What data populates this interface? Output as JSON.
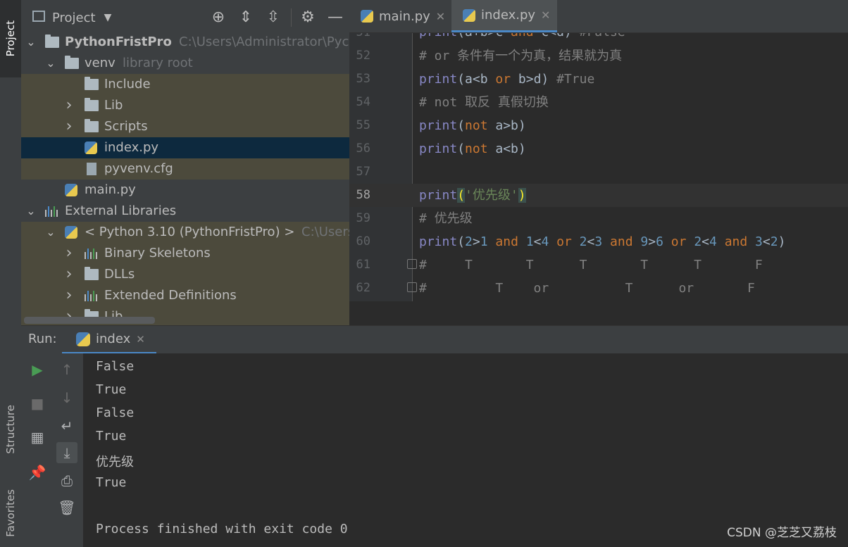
{
  "left_stripe": {
    "project_tab": "Project",
    "structure_tab": "Structure",
    "favorites_tab": "Favorites"
  },
  "project_panel": {
    "title": "Project",
    "tree": [
      {
        "label": "PythonFristPro",
        "extra": "C:\\Users\\Administrator\\Pychar",
        "type": "folder",
        "level": 0,
        "arrow": "down",
        "bold": true
      },
      {
        "label": "venv",
        "extra": "library root",
        "type": "folder",
        "level": 1,
        "arrow": "down"
      },
      {
        "label": "Include",
        "type": "folder",
        "level": 2,
        "arrow": ""
      },
      {
        "label": "Lib",
        "type": "folder",
        "level": 2,
        "arrow": "right"
      },
      {
        "label": "Scripts",
        "type": "folder",
        "level": 2,
        "arrow": "right"
      },
      {
        "label": "index.py",
        "type": "python",
        "level": 2,
        "arrow": "",
        "selected": true
      },
      {
        "label": "pyvenv.cfg",
        "type": "file",
        "level": 2,
        "arrow": ""
      },
      {
        "label": "main.py",
        "type": "python",
        "level": 1,
        "arrow": ""
      },
      {
        "label": "External Libraries",
        "type": "lib",
        "level": 0,
        "arrow": "down"
      },
      {
        "label": "< Python 3.10 (PythonFristPro) >",
        "extra": "C:\\Users\\A",
        "type": "python",
        "level": 1,
        "arrow": "down"
      },
      {
        "label": "Binary Skeletons",
        "type": "lib",
        "level": 2,
        "arrow": "right"
      },
      {
        "label": "DLLs",
        "type": "folder",
        "level": 2,
        "arrow": "right"
      },
      {
        "label": "Extended Definitions",
        "type": "lib",
        "level": 2,
        "arrow": "right"
      },
      {
        "label": "Lib",
        "type": "folder",
        "level": 2,
        "arrow": "right"
      }
    ]
  },
  "editor": {
    "tabs": [
      {
        "label": "main.py",
        "active": false
      },
      {
        "label": "index.py",
        "active": true
      }
    ],
    "lines": [
      {
        "n": "51",
        "current": false,
        "tokens": [
          [
            "fn",
            "print"
          ],
          [
            "p",
            "(a+b>c "
          ],
          [
            "kw",
            "and"
          ],
          [
            "p",
            " c<d) "
          ],
          [
            "cm",
            "#False"
          ]
        ]
      },
      {
        "n": "52",
        "current": false,
        "tokens": [
          [
            "cm",
            "# or 条件有一个为真，结果就为真"
          ]
        ]
      },
      {
        "n": "53",
        "current": false,
        "tokens": [
          [
            "fn",
            "print"
          ],
          [
            "p",
            "(a<b "
          ],
          [
            "kw",
            "or"
          ],
          [
            "p",
            " b>d) "
          ],
          [
            "cm",
            "#True"
          ]
        ]
      },
      {
        "n": "54",
        "current": false,
        "tokens": [
          [
            "cm",
            "# not 取反 真假切换"
          ]
        ]
      },
      {
        "n": "55",
        "current": false,
        "tokens": [
          [
            "fn",
            "print"
          ],
          [
            "p",
            "("
          ],
          [
            "kw",
            "not"
          ],
          [
            "p",
            " a>b)"
          ]
        ]
      },
      {
        "n": "56",
        "current": false,
        "tokens": [
          [
            "fn",
            "print"
          ],
          [
            "p",
            "("
          ],
          [
            "kw",
            "not"
          ],
          [
            "p",
            " a<b)"
          ]
        ]
      },
      {
        "n": "57",
        "current": false,
        "tokens": []
      },
      {
        "n": "58",
        "current": true,
        "tokens": [
          [
            "fn",
            "print"
          ],
          [
            "bm",
            "("
          ],
          [
            "str",
            "'优先级'"
          ],
          [
            "bm",
            ")"
          ]
        ]
      },
      {
        "n": "59",
        "current": false,
        "tokens": [
          [
            "cm",
            "# 优先级"
          ]
        ]
      },
      {
        "n": "60",
        "current": false,
        "tokens": [
          [
            "fn",
            "print"
          ],
          [
            "p",
            "("
          ],
          [
            "num",
            "2"
          ],
          [
            "p",
            ">"
          ],
          [
            "num",
            "1"
          ],
          [
            "p",
            " "
          ],
          [
            "kw",
            "and"
          ],
          [
            "p",
            " "
          ],
          [
            "num",
            "1"
          ],
          [
            "p",
            "<"
          ],
          [
            "num",
            "4"
          ],
          [
            "p",
            " "
          ],
          [
            "kw",
            "or"
          ],
          [
            "p",
            " "
          ],
          [
            "num",
            "2"
          ],
          [
            "p",
            "<"
          ],
          [
            "num",
            "3"
          ],
          [
            "p",
            " "
          ],
          [
            "kw",
            "and"
          ],
          [
            "p",
            " "
          ],
          [
            "num",
            "9"
          ],
          [
            "p",
            ">"
          ],
          [
            "num",
            "6"
          ],
          [
            "p",
            " "
          ],
          [
            "kw",
            "or"
          ],
          [
            "p",
            " "
          ],
          [
            "num",
            "2"
          ],
          [
            "p",
            "<"
          ],
          [
            "num",
            "4"
          ],
          [
            "p",
            " "
          ],
          [
            "kw",
            "and"
          ],
          [
            "p",
            " "
          ],
          [
            "num",
            "3"
          ],
          [
            "p",
            "<"
          ],
          [
            "num",
            "2"
          ],
          [
            "p",
            ")"
          ]
        ]
      },
      {
        "n": "61",
        "current": false,
        "fold": true,
        "tokens": [
          [
            "cm",
            "#     T       T      T       T      T       F"
          ]
        ]
      },
      {
        "n": "62",
        "current": false,
        "fold": true,
        "tokens": [
          [
            "cm",
            "#         T    or          T      or       F"
          ]
        ]
      }
    ]
  },
  "run_panel": {
    "label": "Run:",
    "tab": "index",
    "output": [
      "False",
      "True",
      "False",
      "True",
      "优先级",
      "True",
      "",
      "Process finished with exit code 0"
    ]
  },
  "watermark": "CSDN @芝芝又荔枝"
}
